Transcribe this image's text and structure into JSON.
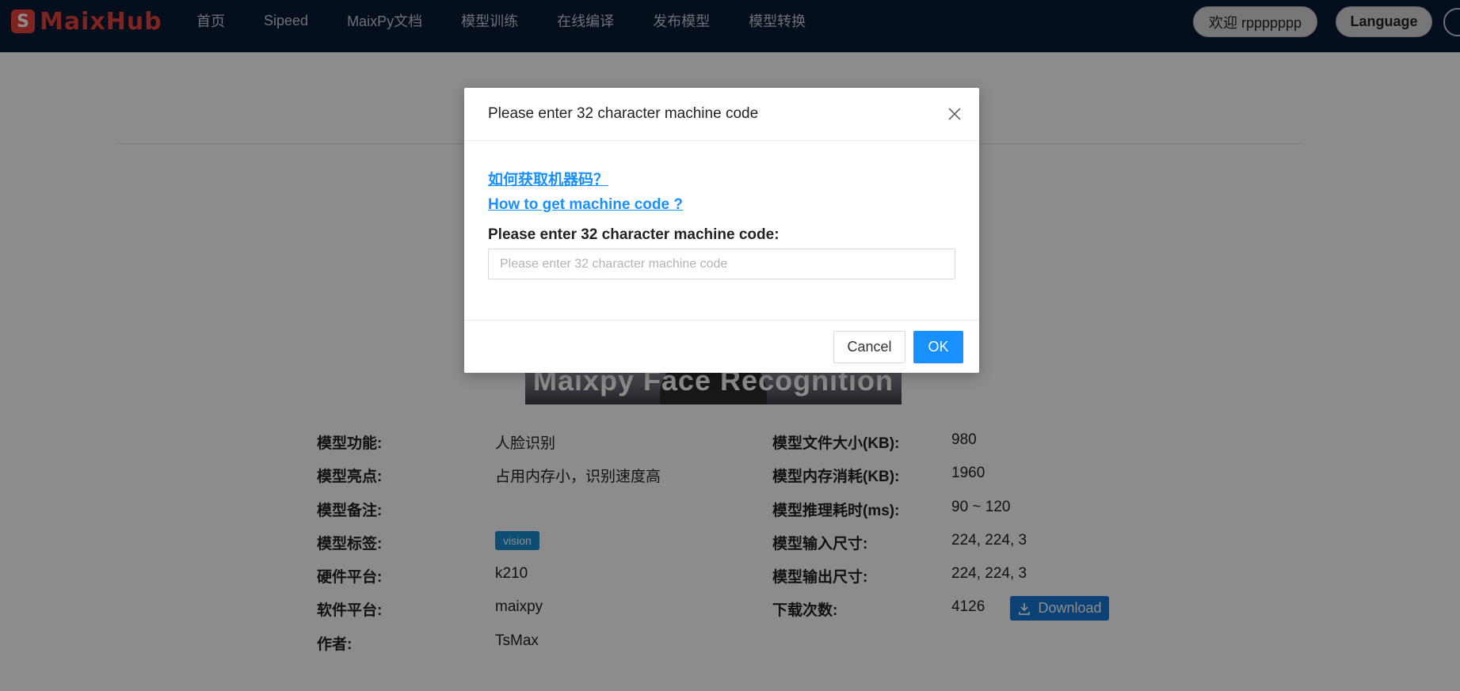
{
  "brand": {
    "logo_letter": "S",
    "name": "MaixHub",
    "color": "#e8433a"
  },
  "nav": {
    "items": [
      "首页",
      "Sipeed",
      "MaixPy文档",
      "模型训练",
      "在线编译",
      "发布模型",
      "模型转换"
    ],
    "welcome": "欢迎 rppppppp",
    "language": "Language"
  },
  "hero": {
    "caption": "Maixpy Face Recognition"
  },
  "model_info": {
    "left": [
      {
        "label": "模型功能:",
        "value": "人脸识别"
      },
      {
        "label": "模型亮点:",
        "value": "占用内存小，识别速度高"
      },
      {
        "label": "模型备注:",
        "value": ""
      },
      {
        "label": "模型标签:",
        "value": "vision"
      },
      {
        "label": "硬件平台:",
        "value": "k210"
      },
      {
        "label": "软件平台:",
        "value": "maixpy"
      },
      {
        "label": "作者:",
        "value": "TsMax"
      }
    ],
    "right": [
      {
        "label": "模型文件大小(KB):",
        "value": "980"
      },
      {
        "label": "模型内存消耗(KB):",
        "value": "1960"
      },
      {
        "label": "模型推理耗时(ms):",
        "value": "90 ~ 120"
      },
      {
        "label": "模型输入尺寸:",
        "value": "224, 224, 3"
      },
      {
        "label": "模型输出尺寸:",
        "value": "224, 224, 3"
      },
      {
        "label": "下载次数:",
        "value": "4126"
      }
    ],
    "download_label": "Download"
  },
  "modal": {
    "title": "Please enter 32 character machine code",
    "help_link_cn": "如何获取机器码？",
    "help_link_en": "How to get machine code ?",
    "field_label": "Please enter 32 character machine code:",
    "input_value": "",
    "input_placeholder": "Please enter 32 character machine code",
    "cancel_label": "Cancel",
    "ok_label": "OK"
  },
  "colors": {
    "nav_bg": "#081a35",
    "primary": "#1890ff",
    "tag": "#1b8fd6"
  }
}
